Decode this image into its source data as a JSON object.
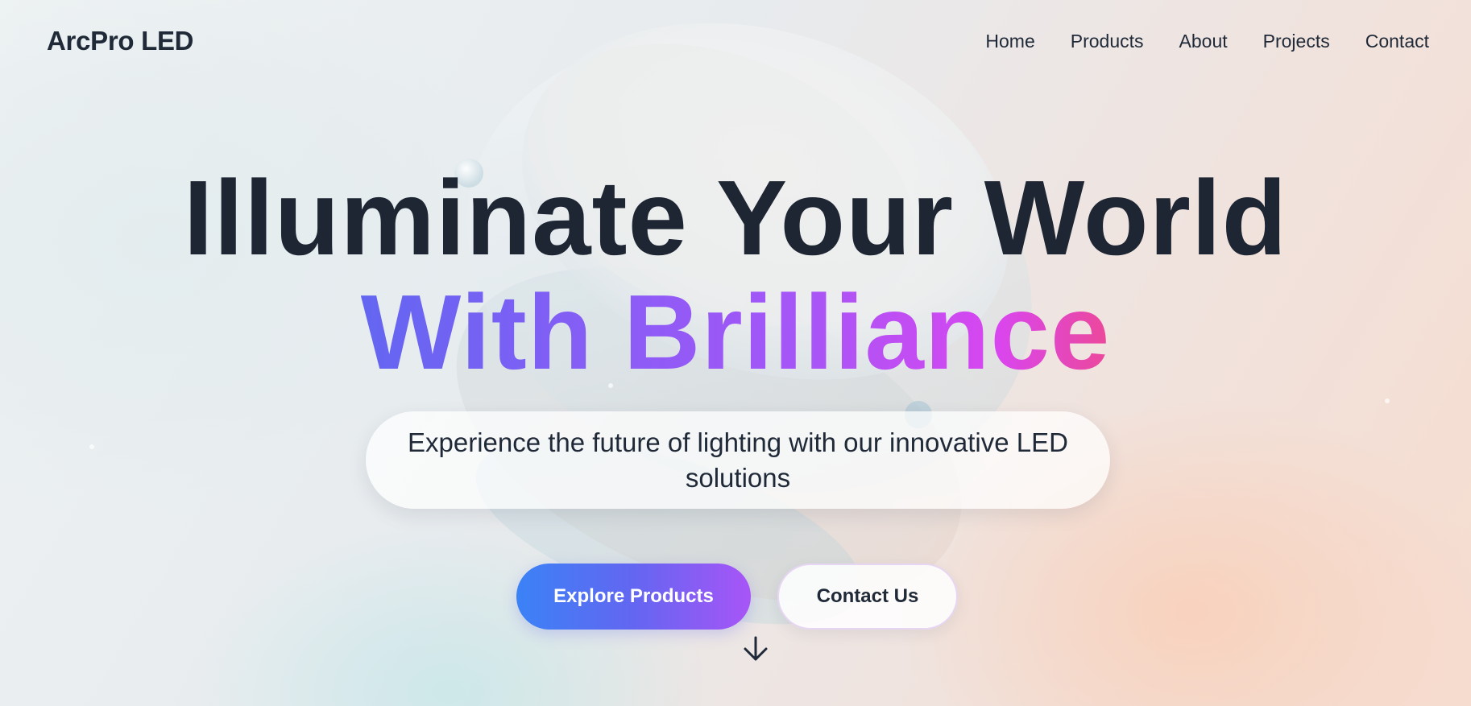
{
  "brand": {
    "logo_text": "ArcPro LED"
  },
  "nav": {
    "items": [
      {
        "label": "Home"
      },
      {
        "label": "Products"
      },
      {
        "label": "About"
      },
      {
        "label": "Projects"
      },
      {
        "label": "Contact"
      }
    ]
  },
  "hero": {
    "headline_line1": "Illuminate Your World",
    "headline_line2": "With Brilliance",
    "subtitle": "Experience the future of lighting with our innovative LED solutions",
    "primary_cta": "Explore Products",
    "secondary_cta": "Contact Us",
    "scroll_icon": "arrow-down-icon"
  },
  "colors": {
    "text_dark": "#1f2937",
    "gradient_start": "#6366f1",
    "gradient_end": "#ec4899",
    "button_gradient_start": "#3b82f6",
    "button_gradient_end": "#a855f7"
  }
}
